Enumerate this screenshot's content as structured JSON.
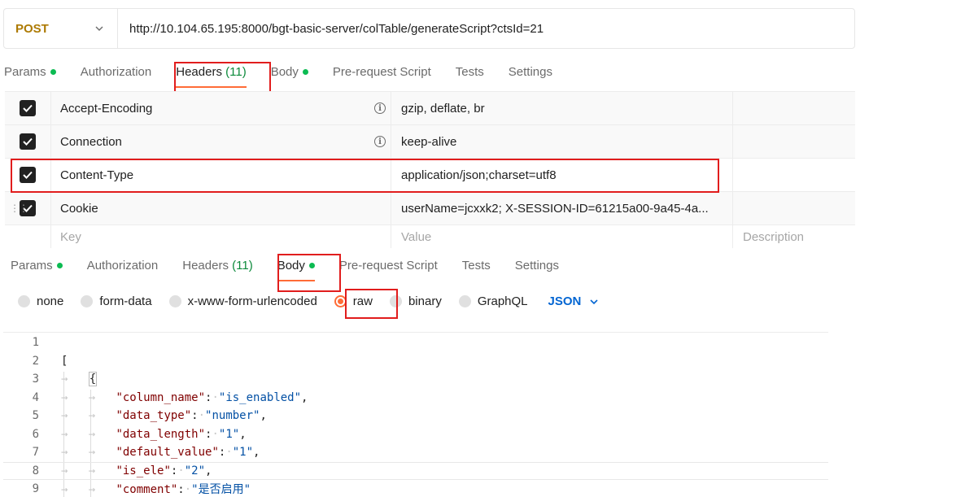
{
  "request": {
    "method": "POST",
    "url": "http://10.104.65.195:8000/bgt-basic-server/colTable/generateScript?ctsId=21"
  },
  "tabs_top": [
    {
      "label": "Params",
      "dot": true
    },
    {
      "label": "Authorization"
    },
    {
      "label": "Headers",
      "count": "(11)",
      "active": true
    },
    {
      "label": "Body",
      "dot": true
    },
    {
      "label": "Pre-request Script"
    },
    {
      "label": "Tests"
    },
    {
      "label": "Settings"
    }
  ],
  "headers_table": {
    "rows": [
      {
        "key": "Accept-Encoding",
        "value": "gzip, deflate, br",
        "info": true
      },
      {
        "key": "Connection",
        "value": "keep-alive",
        "info": true
      },
      {
        "key": "Content-Type",
        "value": "application/json;charset=utf8"
      },
      {
        "key": "Cookie",
        "value": "userName=jcxxk2; X-SESSION-ID=61215a00-9a45-4a..."
      }
    ],
    "placeholder": {
      "key": "Key",
      "value": "Value",
      "description": "Description"
    }
  },
  "tabs_bottom": [
    {
      "label": "Params",
      "dot": true
    },
    {
      "label": "Authorization"
    },
    {
      "label": "Headers",
      "count": "(11)"
    },
    {
      "label": "Body",
      "dot": true,
      "active": true
    },
    {
      "label": "Pre-request Script"
    },
    {
      "label": "Tests"
    },
    {
      "label": "Settings"
    }
  ],
  "body_types": [
    {
      "label": "none"
    },
    {
      "label": "form-data"
    },
    {
      "label": "x-www-form-urlencoded"
    },
    {
      "label": "raw",
      "selected": true
    },
    {
      "label": "binary"
    },
    {
      "label": "GraphQL"
    }
  ],
  "body_format": "JSON",
  "code_lines": [
    {
      "n": "1",
      "text": ""
    },
    {
      "n": "2",
      "text": "["
    },
    {
      "n": "3",
      "text": "{"
    },
    {
      "n": "4",
      "key": "\"column_name\"",
      "val": "\"is_enabled\"",
      "comma": ","
    },
    {
      "n": "5",
      "key": "\"data_type\"",
      "val": "\"number\"",
      "comma": ","
    },
    {
      "n": "6",
      "key": "\"data_length\"",
      "val": "\"1\"",
      "comma": ","
    },
    {
      "n": "7",
      "key": "\"default_value\"",
      "val": "\"1\"",
      "comma": ","
    },
    {
      "n": "8",
      "key": "\"is_ele\"",
      "val": "\"2\"",
      "comma": ","
    },
    {
      "n": "9",
      "key": "\"comment\"",
      "val": "\"是否启用\"",
      "comma": ""
    }
  ],
  "colors": {
    "accent": "#ff6c37",
    "method": "#ad7a03",
    "highlight_box": "#e11d1d",
    "json_link": "#0265d2"
  }
}
